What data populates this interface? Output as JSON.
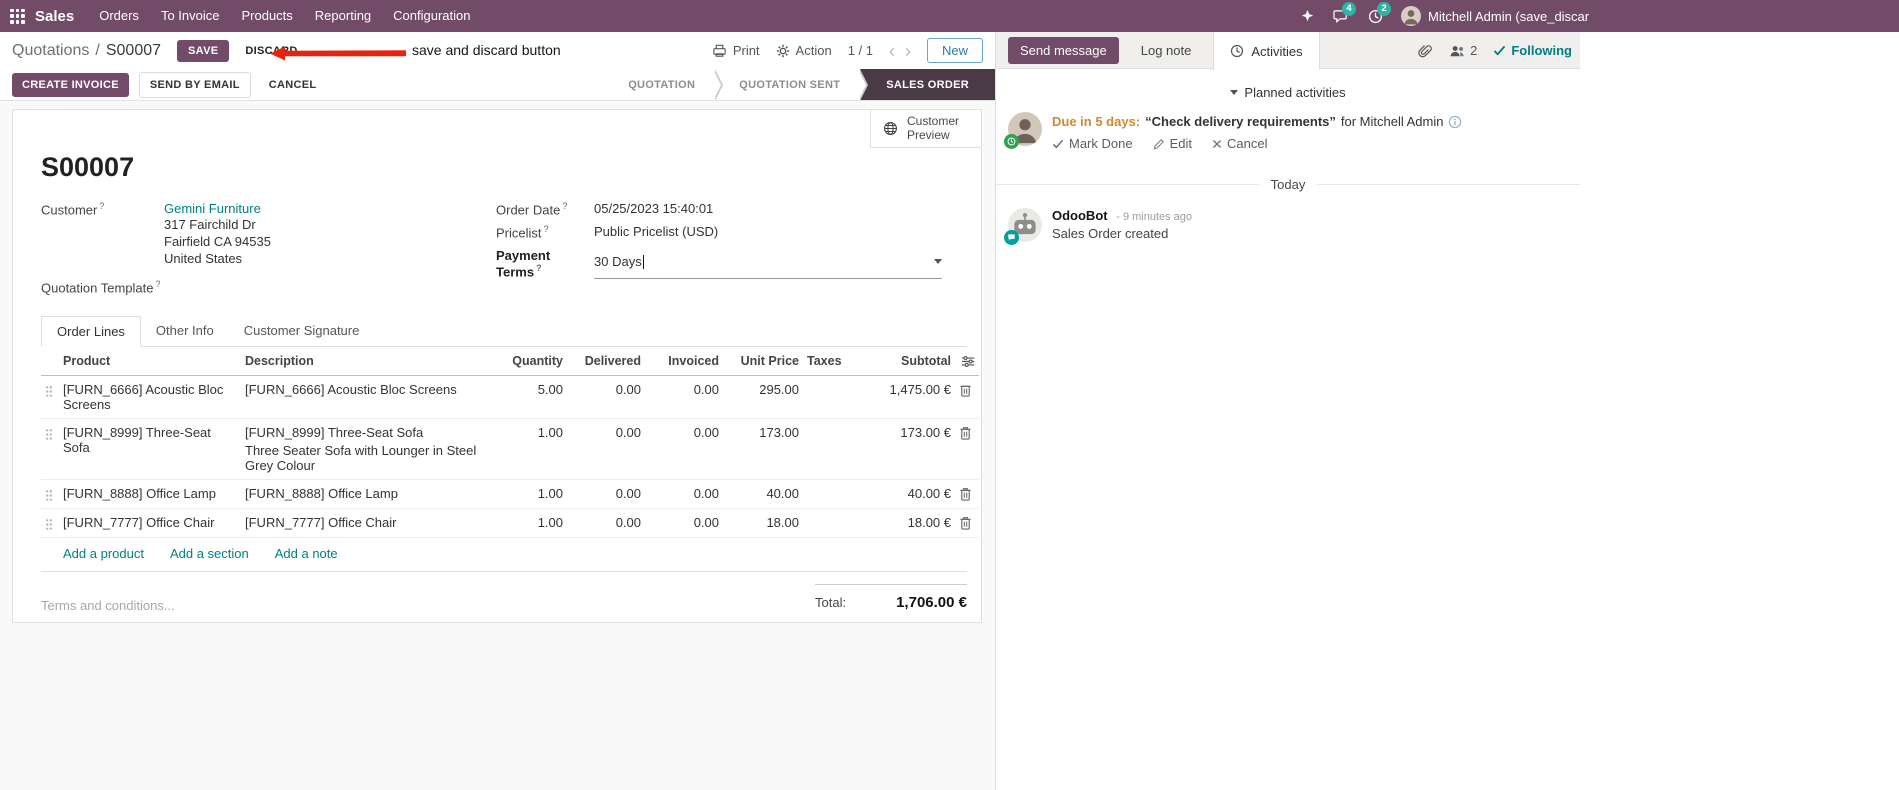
{
  "colors": {
    "brand": "#714B67",
    "link": "#017E84",
    "edited": "#2878C8",
    "due": "#CE8A2E",
    "stage-active": "#493A45",
    "annotation": "#E8230D",
    "badge": "#2EB3A6"
  },
  "topnav": {
    "app_name": "Sales",
    "menus": [
      "Orders",
      "To Invoice",
      "Products",
      "Reporting",
      "Configuration"
    ],
    "message_badge": "4",
    "activity_badge": "2",
    "user_name": "Mitchell Admin (save_discar"
  },
  "control_panel": {
    "breadcrumb_parent": "Quotations",
    "breadcrumb_separator": "/",
    "record_name": "S00007",
    "save": "SAVE",
    "discard": "DISCARD",
    "annotation": "save and discard button",
    "print": "Print",
    "action": "Action",
    "pager": "1 / 1",
    "new": "New"
  },
  "statusbar": {
    "create_invoice": "CREATE INVOICE",
    "send_by_email": "SEND BY EMAIL",
    "cancel": "CANCEL",
    "stages": [
      {
        "label": "QUOTATION"
      },
      {
        "label": "QUOTATION SENT"
      },
      {
        "label": "SALES ORDER"
      }
    ]
  },
  "sheet": {
    "customer_preview": "Customer Preview",
    "title": "S00007",
    "help_marker": "?",
    "customer": {
      "label": "Customer",
      "name": "Gemini Furniture",
      "address1": "317 Fairchild Dr",
      "address2": "Fairfield CA 94535",
      "address3": "United States"
    },
    "quotation_template": {
      "label": "Quotation Template"
    },
    "order_date": {
      "label": "Order Date",
      "value": "05/25/2023 15:40:01"
    },
    "pricelist": {
      "label": "Pricelist",
      "value": "Public Pricelist (USD)"
    },
    "payment_terms": {
      "label": "Payment Terms",
      "value": "30 Days"
    },
    "tabs": [
      {
        "label": "Order Lines"
      },
      {
        "label": "Other Info"
      },
      {
        "label": "Customer Signature"
      }
    ],
    "table": {
      "headers": [
        "Product",
        "Description",
        "Quantity",
        "Delivered",
        "Invoiced",
        "Unit Price",
        "Taxes",
        "Subtotal"
      ],
      "rows": [
        {
          "product": "[FURN_6666] Acoustic Bloc Screens",
          "description": "[FURN_6666] Acoustic Bloc Screens",
          "quantity": "5.00",
          "delivered": "0.00",
          "invoiced": "0.00",
          "unit_price": "295.00",
          "taxes": "",
          "subtotal": "1,475.00 €"
        },
        {
          "product": "[FURN_8999] Three-Seat Sofa",
          "description": "[FURN_8999] Three-Seat Sofa",
          "description2": "Three Seater Sofa with Lounger in Steel Grey Colour",
          "quantity": "1.00",
          "delivered": "0.00",
          "invoiced": "0.00",
          "unit_price": "173.00",
          "taxes": "",
          "subtotal": "173.00 €"
        },
        {
          "product": "[FURN_8888] Office Lamp",
          "description": "[FURN_8888] Office Lamp",
          "quantity": "1.00",
          "delivered": "0.00",
          "invoiced": "0.00",
          "unit_price": "40.00",
          "taxes": "",
          "subtotal": "40.00 €"
        },
        {
          "product": "[FURN_7777] Office Chair",
          "description": "[FURN_7777] Office Chair",
          "quantity": "1.00",
          "delivered": "0.00",
          "invoiced": "0.00",
          "unit_price": "18.00",
          "taxes": "",
          "subtotal": "18.00 €"
        }
      ],
      "add_product": "Add a product",
      "add_section": "Add a section",
      "add_note": "Add a note"
    },
    "terms_placeholder": "Terms and conditions...",
    "total_label": "Total:",
    "total_value": "1,706.00 €"
  },
  "chatter": {
    "send_message": "Send message",
    "log_note": "Log note",
    "activities": "Activities",
    "followers_count": "2",
    "following": "Following",
    "planned_activities": "Planned activities",
    "activity": {
      "due": "Due in 5 days:",
      "summary": "“Check delivery requirements”",
      "assignee": "for Mitchell Admin",
      "mark_done": "Mark Done",
      "edit": "Edit",
      "cancel": "Cancel"
    },
    "today": "Today",
    "message": {
      "author": "OdooBot",
      "time": "- 9 minutes ago",
      "body": "Sales Order created"
    }
  },
  "icons": {
    "apps-menu": "grid",
    "star": "sparkle",
    "messages": "chat-bubble",
    "activities": "clock",
    "print": "printer",
    "action": "gear",
    "pager-previous": "chevron-left",
    "pager-next": "chevron-right",
    "customer-preview": "globe",
    "payment-terms-dropdown": "caret-down",
    "drag-handle": "six-dots",
    "delete-line": "trash",
    "optional-columns": "sliders",
    "attachment": "paperclip",
    "followers": "user-group",
    "following": "check",
    "activity-state": "clock",
    "mark-done": "check",
    "edit": "pencil",
    "cancel": "x",
    "info": "info-circle"
  }
}
